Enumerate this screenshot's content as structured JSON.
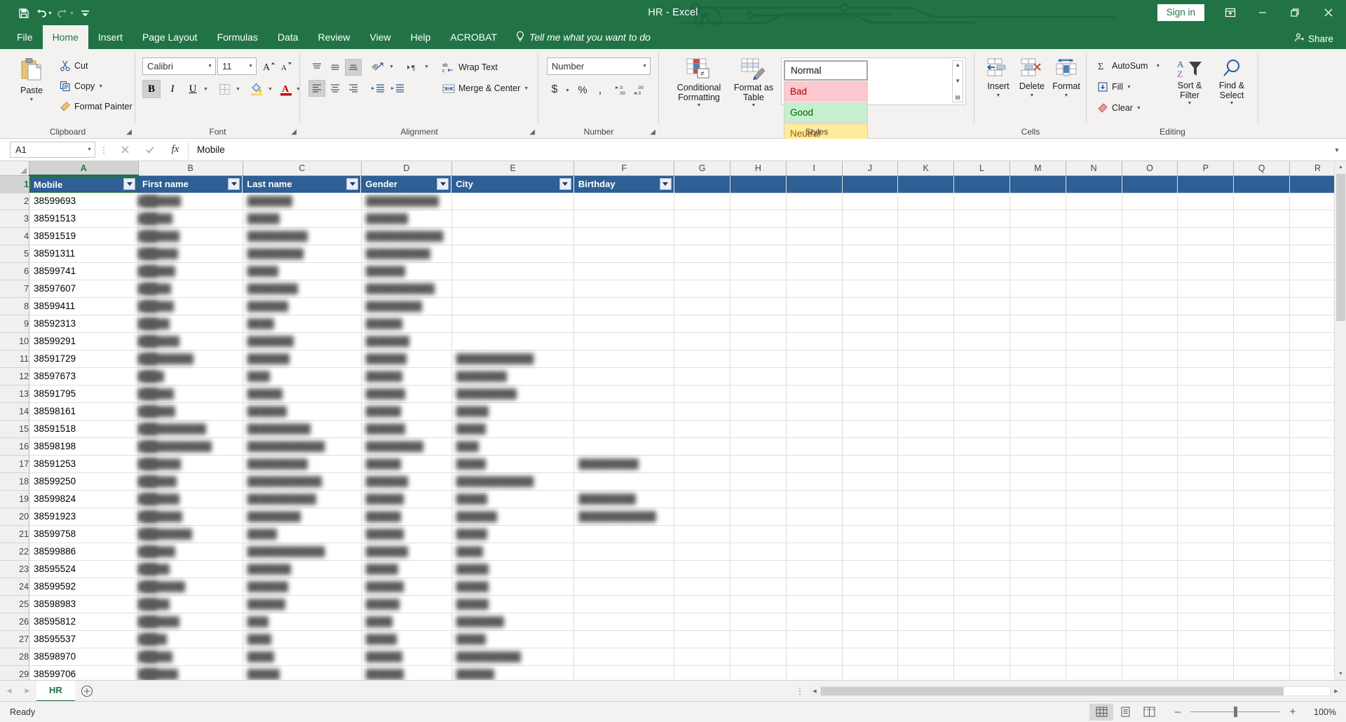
{
  "window": {
    "title": "HR  -  Excel",
    "signin_label": "Sign in",
    "ribbon_display_icon": "ribbon-display-options-icon",
    "minimize_icon": "minimize-icon",
    "restore_icon": "restore-icon",
    "close_icon": "close-icon"
  },
  "qat": {
    "save": "save-icon",
    "undo": "undo-icon",
    "redo": "redo-icon",
    "customize": "customize-qat-icon"
  },
  "tabs": [
    {
      "label": "File",
      "active": false
    },
    {
      "label": "Home",
      "active": true
    },
    {
      "label": "Insert",
      "active": false
    },
    {
      "label": "Page Layout",
      "active": false
    },
    {
      "label": "Formulas",
      "active": false
    },
    {
      "label": "Data",
      "active": false
    },
    {
      "label": "Review",
      "active": false
    },
    {
      "label": "View",
      "active": false
    },
    {
      "label": "Help",
      "active": false
    },
    {
      "label": "ACROBAT",
      "active": false
    }
  ],
  "tellme": {
    "label": "Tell me what you want to do",
    "icon": "lightbulb-icon"
  },
  "share": {
    "label": "Share",
    "icon": "share-person-icon"
  },
  "ribbon": {
    "clipboard": {
      "group_label": "Clipboard",
      "paste": "Paste",
      "cut": "Cut",
      "copy": "Copy",
      "format_painter": "Format Painter"
    },
    "font": {
      "group_label": "Font",
      "font_name": "Calibri",
      "font_size": "11",
      "grow_font": "A",
      "shrink_font": "A",
      "bold": "B",
      "italic": "I",
      "underline": "U"
    },
    "alignment": {
      "group_label": "Alignment",
      "wrap_text": "Wrap Text",
      "merge_center": "Merge & Center"
    },
    "number": {
      "group_label": "Number",
      "format": "Number",
      "currency": "$",
      "percent": "%",
      "comma": ","
    },
    "styles": {
      "group_label": "Styles",
      "conditional_formatting": "Conditional Formatting",
      "format_as_table": "Format as Table",
      "cells": [
        {
          "label": "Normal",
          "kind": "normal"
        },
        {
          "label": "Bad",
          "kind": "bad"
        },
        {
          "label": "Good",
          "kind": "good"
        },
        {
          "label": "Neutral",
          "kind": "neutral"
        }
      ]
    },
    "cells": {
      "group_label": "Cells",
      "insert": "Insert",
      "delete": "Delete",
      "format": "Format"
    },
    "editing": {
      "group_label": "Editing",
      "autosum": "AutoSum",
      "fill": "Fill",
      "clear": "Clear",
      "sort_filter": "Sort & Filter",
      "find_select": "Find & Select"
    }
  },
  "formula_bar": {
    "name_box": "A1",
    "cancel_icon": "cancel-icon",
    "enter_icon": "confirm-icon",
    "function_icon": "insert-function-icon",
    "value": "Mobile"
  },
  "grid": {
    "column_letters": [
      "A",
      "B",
      "C",
      "D",
      "E",
      "F",
      "G",
      "H",
      "I",
      "J",
      "K",
      "L",
      "M",
      "N",
      "O",
      "P",
      "Q",
      "R"
    ],
    "selected_column": "A",
    "selected_row": 1,
    "active_cell": "A1",
    "header_row_index": 1,
    "table_headers": [
      "Mobile",
      "First name",
      "Last name",
      "Gender",
      "City",
      "Birthday"
    ],
    "row_numbers": [
      1,
      2,
      3,
      4,
      5,
      6,
      7,
      8,
      9,
      10,
      11,
      12,
      13,
      14,
      15,
      16,
      17,
      18,
      19,
      20,
      21,
      22,
      23,
      24,
      25,
      26,
      27,
      28,
      29
    ],
    "rows": [
      {
        "n": 2,
        "mobile": "38599693"
      },
      {
        "n": 3,
        "mobile": "38591513"
      },
      {
        "n": 4,
        "mobile": "38591519"
      },
      {
        "n": 5,
        "mobile": "38591311"
      },
      {
        "n": 6,
        "mobile": "38599741"
      },
      {
        "n": 7,
        "mobile": "38597607"
      },
      {
        "n": 8,
        "mobile": "38599411"
      },
      {
        "n": 9,
        "mobile": "38592313"
      },
      {
        "n": 10,
        "mobile": "38599291"
      },
      {
        "n": 11,
        "mobile": "38591729"
      },
      {
        "n": 12,
        "mobile": "38597673"
      },
      {
        "n": 13,
        "mobile": "38591795"
      },
      {
        "n": 14,
        "mobile": "38598161"
      },
      {
        "n": 15,
        "mobile": "38591518"
      },
      {
        "n": 16,
        "mobile": "38598198"
      },
      {
        "n": 17,
        "mobile": "38591253"
      },
      {
        "n": 18,
        "mobile": "38599250"
      },
      {
        "n": 19,
        "mobile": "38599824"
      },
      {
        "n": 20,
        "mobile": "38591923"
      },
      {
        "n": 21,
        "mobile": "38599758"
      },
      {
        "n": 22,
        "mobile": "38599886"
      },
      {
        "n": 23,
        "mobile": "38595524"
      },
      {
        "n": 24,
        "mobile": "38599592"
      },
      {
        "n": 25,
        "mobile": "38598983"
      },
      {
        "n": 26,
        "mobile": "38595812"
      },
      {
        "n": 27,
        "mobile": "38595537"
      },
      {
        "n": 28,
        "mobile": "38598970"
      },
      {
        "n": 29,
        "mobile": "38599706"
      }
    ]
  },
  "sheet_tabs": {
    "sheets": [
      {
        "label": "HR",
        "active": true
      }
    ],
    "add_sheet_icon": "add-sheet-icon",
    "prev_icon": "prev-sheet-icon",
    "next_icon": "next-sheet-icon"
  },
  "status_bar": {
    "status": "Ready",
    "views": [
      {
        "name": "normal-view",
        "active": true
      },
      {
        "name": "page-layout-view",
        "active": false
      },
      {
        "name": "page-break-preview",
        "active": false
      }
    ],
    "zoom_out": "–",
    "zoom_in": "+",
    "zoom_value": "100%"
  },
  "colors": {
    "brand_green": "#217346",
    "table_header_blue": "#2e5f95",
    "bad_bg": "#ffc7ce",
    "good_bg": "#c6efce",
    "neutral_bg": "#ffeb9c"
  }
}
